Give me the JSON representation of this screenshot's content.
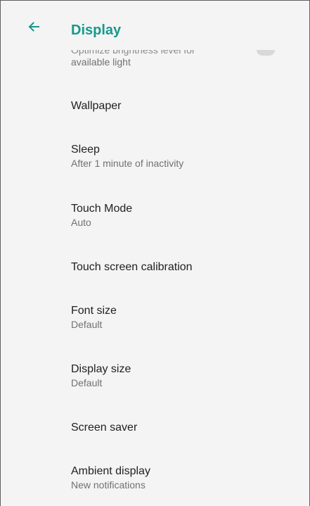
{
  "app_bar": {
    "title": "Display",
    "back_icon": "arrow-left-icon",
    "accent_color": "#16998b"
  },
  "adaptive_brightness": {
    "summary_partial": "Optimize brightness level for",
    "summary_visible": "available light",
    "toggle_state": "off"
  },
  "items": [
    {
      "title": "Wallpaper",
      "summary": ""
    },
    {
      "title": "Sleep",
      "summary": "After 1 minute of inactivity"
    },
    {
      "title": "Touch Mode",
      "summary": "Auto"
    },
    {
      "title": "Touch screen calibration",
      "summary": ""
    },
    {
      "title": "Font size",
      "summary": "Default"
    },
    {
      "title": "Display size",
      "summary": "Default"
    },
    {
      "title": "Screen saver",
      "summary": ""
    },
    {
      "title": "Ambient display",
      "summary": "New notifications"
    }
  ]
}
